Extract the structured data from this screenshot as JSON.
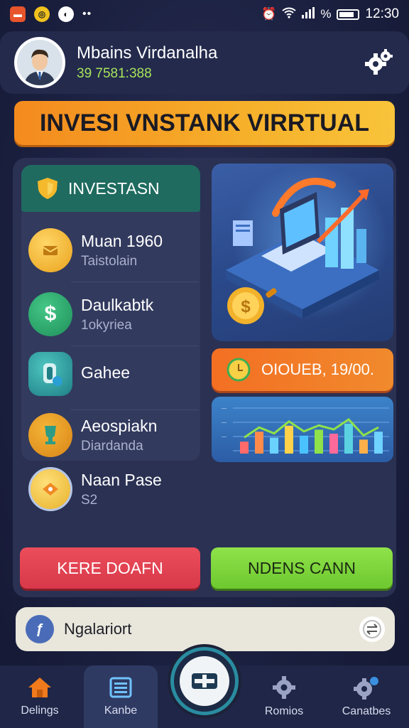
{
  "status_bar": {
    "time": "12:30",
    "battery": "%"
  },
  "header": {
    "user_name": "Mbains Virdanalha",
    "balance": "39 7581:388"
  },
  "banner": {
    "title": "INVESI VNSTANK VIRRTUAL"
  },
  "invest_panel": {
    "title": "INVESTASN",
    "items": [
      {
        "title": "Muan 1960",
        "subtitle": "Taistolain",
        "icon": "coin-icon"
      },
      {
        "title": "Daulkabtk",
        "subtitle": "1okyriea",
        "icon": "dollar-icon"
      },
      {
        "title": "Gahee",
        "subtitle": "",
        "icon": "card-icon"
      },
      {
        "title": "Aeospiakn",
        "subtitle": "Diardanda",
        "icon": "trophy-icon"
      },
      {
        "title": "Naan Pase",
        "subtitle": "S2",
        "icon": "badge-icon"
      }
    ]
  },
  "amount_button": {
    "label": "OIOUEB, 19/00."
  },
  "mini_chart": {
    "bars": [
      0.3,
      0.55,
      0.4,
      0.7,
      0.45,
      0.6,
      0.5,
      0.75,
      0.35,
      0.55
    ]
  },
  "buttons": {
    "red_label": "KERE DOAFN",
    "green_label": "NDENS CANN"
  },
  "search": {
    "placeholder": "Ngalariort"
  },
  "bottom_nav": {
    "items": [
      {
        "label": "Delings",
        "icon": "home-icon"
      },
      {
        "label": "Kanbe",
        "icon": "list-icon"
      },
      {
        "label": "Romios",
        "icon": "gear-icon"
      },
      {
        "label": "Canatbes",
        "icon": "settings-icon"
      }
    ]
  },
  "colors": {
    "accent_orange": "#f48a1e",
    "accent_green": "#8fe24a",
    "accent_red": "#ec4d5a",
    "background": "#1b2040"
  }
}
